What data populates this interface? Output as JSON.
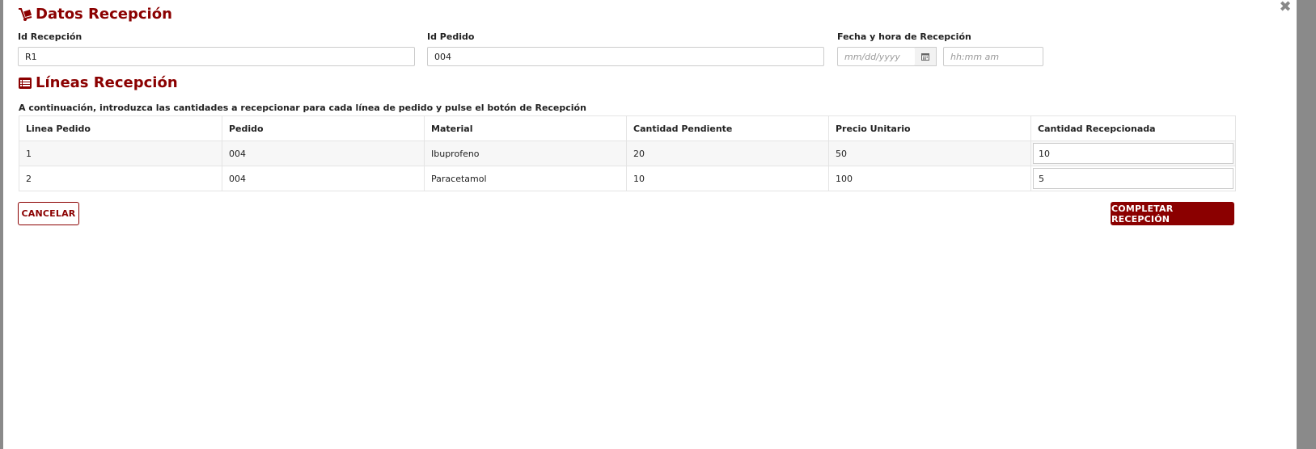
{
  "header": {
    "title": "Datos Recepción",
    "title_icon": "dolly-icon",
    "close_icon": "close-icon",
    "brand_color": "#8b0000"
  },
  "form": {
    "id_recepcion": {
      "label": "Id Recepción",
      "value": "R1"
    },
    "id_pedido": {
      "label": "Id Pedido",
      "value": "004"
    },
    "fecha_hora": {
      "label": "Fecha y hora de Recepción",
      "date_placeholder": "mm/dd/yyyy",
      "time_placeholder": "hh:mm am",
      "calendar_icon": "calendar-icon"
    }
  },
  "lines": {
    "title": "Líneas Recepción",
    "title_icon": "list-icon",
    "instructions": "A continuación, introduzca las cantidades a recepcionar para cada línea de pedido y pulse el botón de Recepción",
    "columns": [
      "Linea Pedido",
      "Pedido",
      "Material",
      "Cantidad Pendiente",
      "Precio Unitario",
      "Cantidad Recepcionada"
    ],
    "rows": [
      {
        "linea": "1",
        "pedido": "004",
        "material": "Ibuprofeno",
        "pendiente": "20",
        "precio": "50",
        "recepcionada": "10"
      },
      {
        "linea": "2",
        "pedido": "004",
        "material": "Paracetamol",
        "pendiente": "10",
        "precio": "100",
        "recepcionada": "5"
      }
    ]
  },
  "actions": {
    "cancel_label": "CANCELAR",
    "complete_label": "COMPLETAR RECEPCIÓN"
  }
}
